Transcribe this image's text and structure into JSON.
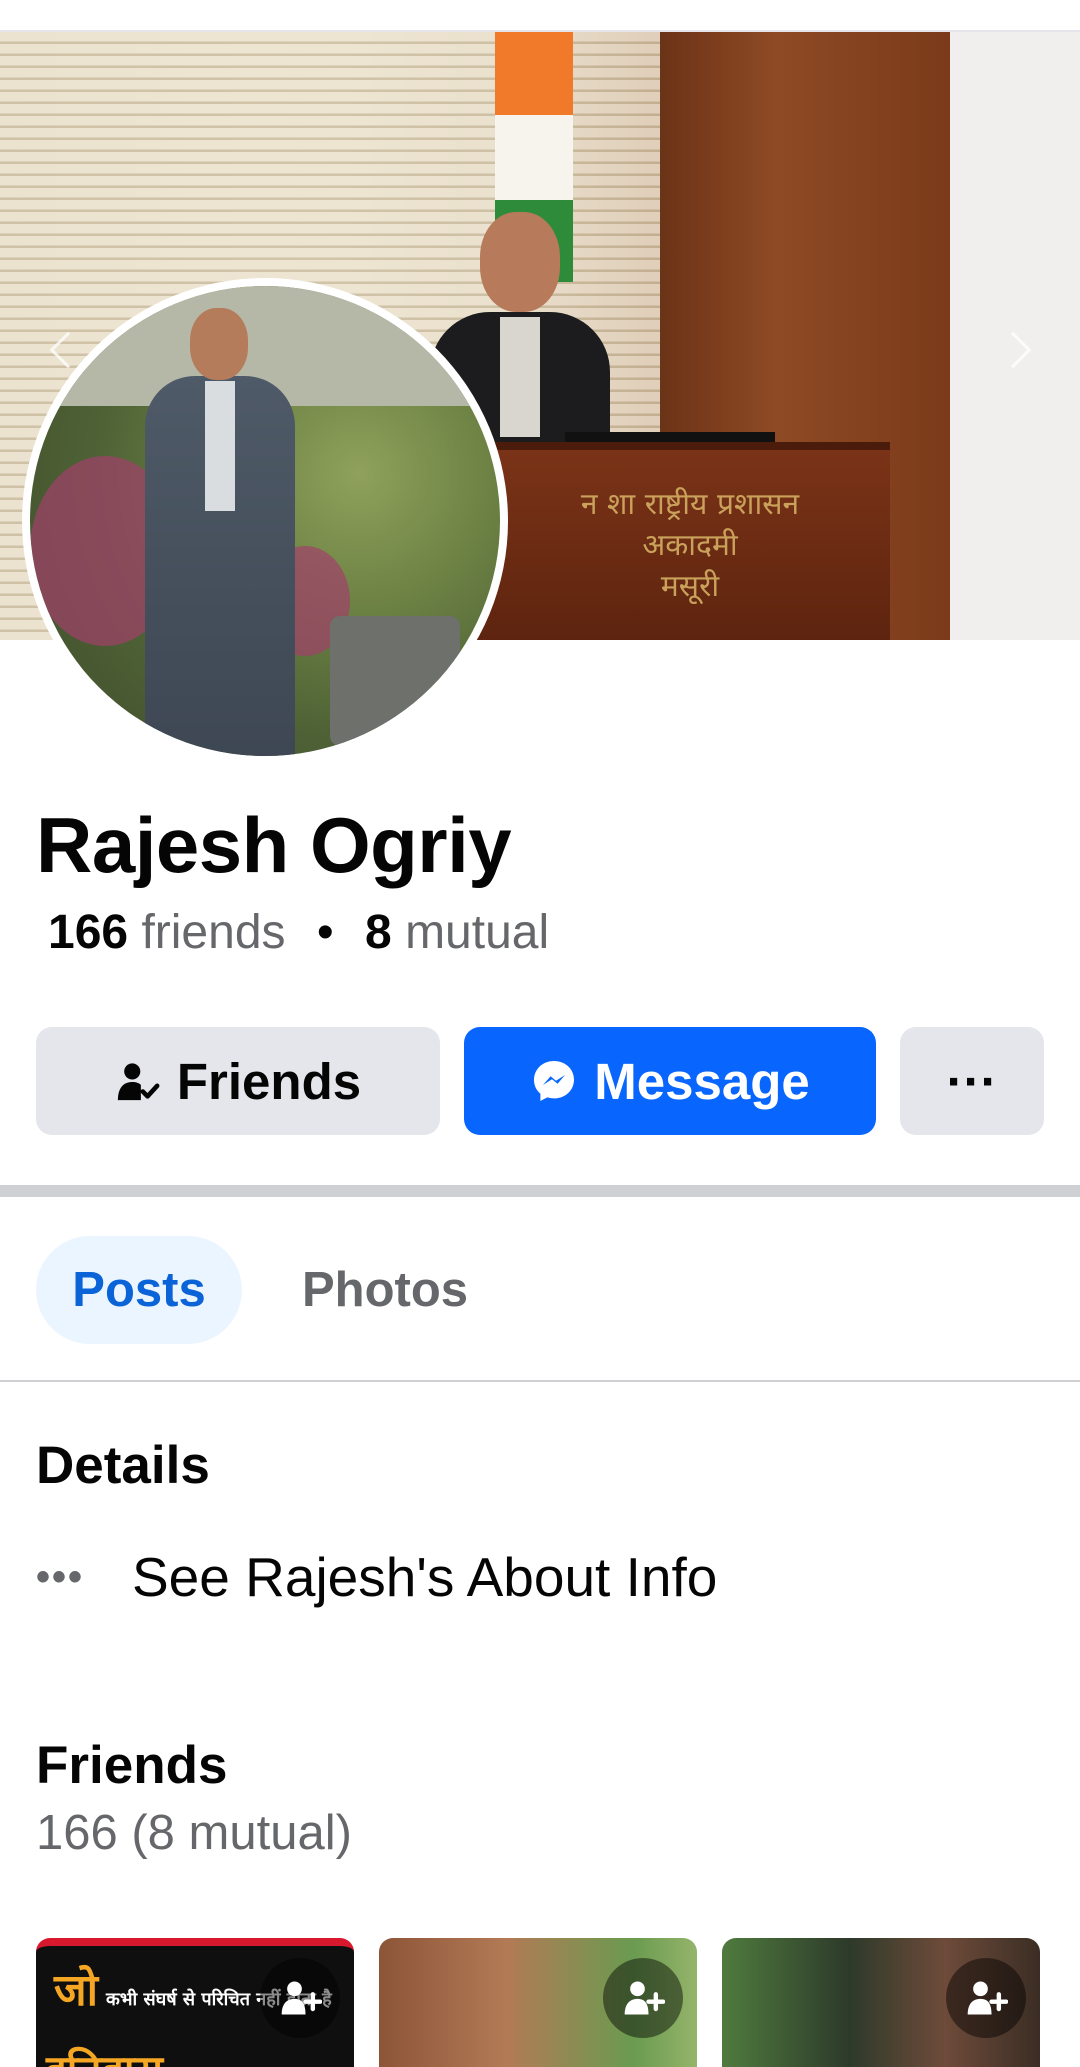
{
  "profile": {
    "name": "Rajesh Ogriy",
    "friends_count": "166",
    "friends_label": "friends",
    "mutual_count": "8",
    "mutual_label": "mutual"
  },
  "cover": {
    "podium_text": "न शा राष्ट्रीय प्रशासन अकादमी",
    "podium_text2": "मसूरी"
  },
  "actions": {
    "friends_label": "Friends",
    "message_label": "Message",
    "more_label": "···"
  },
  "tabs": [
    {
      "label": "Posts",
      "active": true
    },
    {
      "label": "Photos",
      "active": false
    }
  ],
  "details": {
    "title": "Details",
    "about_link": "See Rajesh's About Info"
  },
  "friends_section": {
    "title": "Friends",
    "subtitle": "166 (8 mutual)",
    "tiles": [
      {
        "caption_big": "जो",
        "caption_small": "कभी संघर्ष से परिचित नहीं होता है",
        "caption_bottom": "इतिहास"
      },
      {},
      {}
    ]
  },
  "colors": {
    "accent": "#0866ff",
    "tab_active_bg": "#ebf5ff",
    "tab_active_text": "#0a64d8",
    "secondary_button": "#e4e6eb"
  },
  "icons": {
    "friends_button": "person-check-icon",
    "message_button": "messenger-icon",
    "details_more": "more-dots-icon",
    "add_friend": "add-friend-icon"
  }
}
